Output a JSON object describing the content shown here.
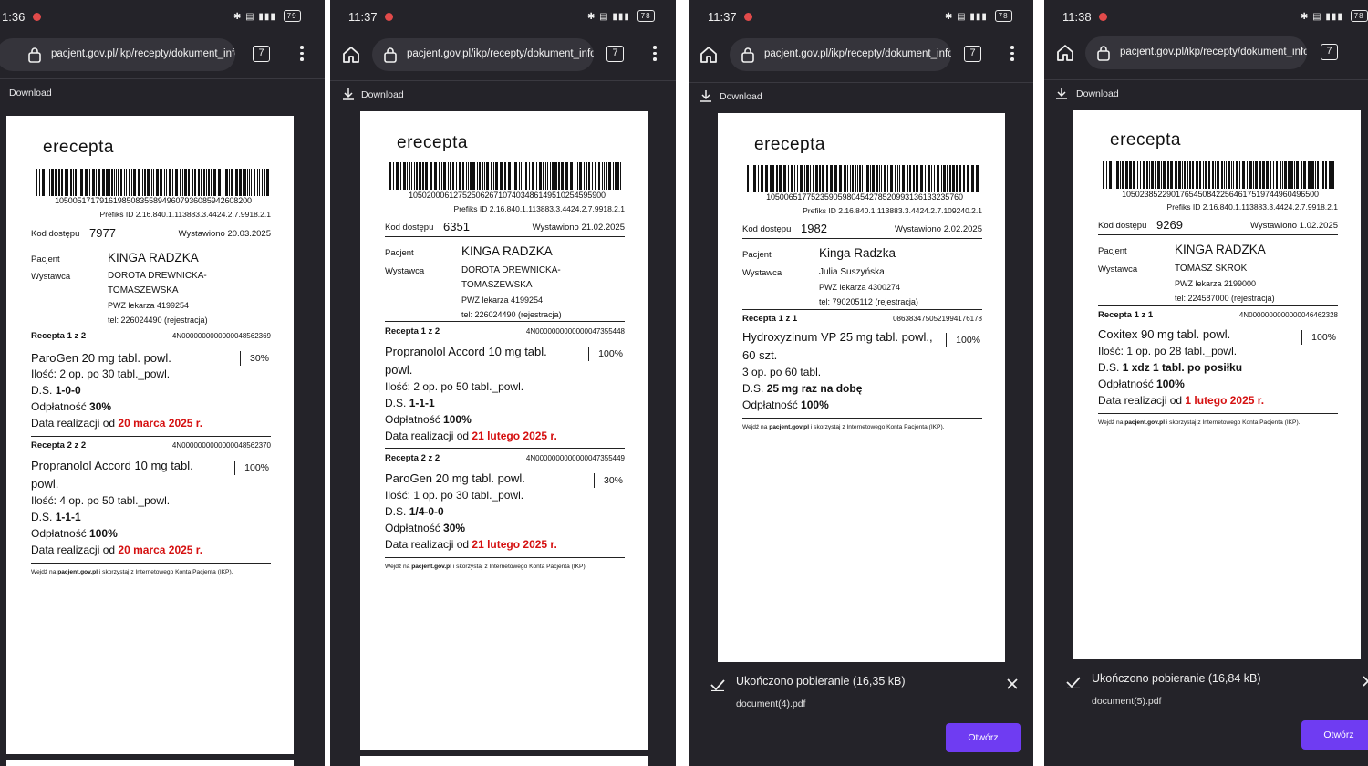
{
  "panels": [
    {
      "status_time": "1:36",
      "battery": "79",
      "url": "pacjent.gov.pl/ikp/recepty/dokument_info",
      "tab_count": "7",
      "download_label": "Download",
      "doc": {
        "logo": "erecepta",
        "barcode_number": "1050051717916198508355894960793608594260820​0",
        "prefix": "Prefiks ID 2.16.840.1.113883.3.4424.2.7.9918.2.1",
        "kod_label": "Kod dostępu",
        "kod_value": "7977",
        "wystawiono_label": "Wystawiono",
        "wystawiono_date": "20.03.2025",
        "pacjent_label": "Pacjent",
        "pacjent_name": "KINGA RADZKA",
        "wystawca_label": "Wystawca",
        "wystawca_lines": [
          "DOROTA DREWNICKA-",
          "TOMASZEWSKA",
          "PWZ lekarza 4199254",
          "tel: 226024490 (rejestracja)"
        ],
        "recepty": [
          {
            "title": "Recepta 1 z 2",
            "id": "4N0000000000000048562369",
            "drug": "ParoGen 20 mg tabl. powl.",
            "pct": "30%",
            "ilosc": "Ilość: 2 op. po 30 tabl._powl.",
            "ds_label": "D.S.",
            "ds_value": "1-0-0",
            "odp_label": "Odpłatność",
            "odp_value": "30%",
            "data_label": "Data realizacji od",
            "data_value": "20 marca 2025 r."
          },
          {
            "title": "Recepta 2 z 2",
            "id": "4N0000000000000048562370",
            "drug": "Propranolol Accord 10 mg tabl. powl.",
            "pct": "100%",
            "ilosc": "Ilość: 4 op. po 50 tabl._powl.",
            "ds_label": "D.S.",
            "ds_value": "1-1-1",
            "odp_label": "Odpłatność",
            "odp_value": "100%",
            "data_label": "Data realizacji od",
            "data_value": "20 marca 2025 r."
          }
        ],
        "footer_pre": "Wejdź na ",
        "footer_link": "pacjent.gov.pl",
        "footer_post": " i skorzystaj z Internetowego Konta Pacjenta (IKP)."
      }
    },
    {
      "status_time": "11:37",
      "battery": "78",
      "url": "pacjent.gov.pl/ikp/recepty/dokument_info",
      "tab_count": "7",
      "download_label": "Download",
      "doc": {
        "logo": "erecepta",
        "barcode_number": "1050200061275250626710740348614951025459590​0",
        "prefix": "Prefiks ID 2.16.840.1.113883.3.4424.2.7.9918.2.1",
        "kod_label": "Kod dostępu",
        "kod_value": "6351",
        "wystawiono_label": "Wystawiono",
        "wystawiono_date": "21.02.2025",
        "pacjent_label": "Pacjent",
        "pacjent_name": "KINGA RADZKA",
        "wystawca_label": "Wystawca",
        "wystawca_lines": [
          "DOROTA DREWNICKA-",
          "TOMASZEWSKA",
          "PWZ lekarza 4199254",
          "tel: 226024490 (rejestracja)"
        ],
        "recepty": [
          {
            "title": "Recepta 1 z 2",
            "id": "4N0000000000000047355448",
            "drug": "Propranolol Accord 10 mg tabl. powl.",
            "pct": "100%",
            "ilosc": "Ilość: 2 op. po 50 tabl._powl.",
            "ds_label": "D.S.",
            "ds_value": "1-1-1",
            "odp_label": "Odpłatność",
            "odp_value": "100%",
            "data_label": "Data realizacji od",
            "data_value": "21 lutego 2025 r."
          },
          {
            "title": "Recepta 2 z 2",
            "id": "4N0000000000000047355449",
            "drug": "ParoGen 20 mg tabl. powl.",
            "pct": "30%",
            "ilosc": "Ilość: 1 op. po 30 tabl._powl.",
            "ds_label": "D.S.",
            "ds_value": "1/4-0-0",
            "odp_label": "Odpłatność",
            "odp_value": "30%",
            "data_label": "Data realizacji od",
            "data_value": "21 lutego 2025 r."
          }
        ],
        "footer_pre": "Wejdź na ",
        "footer_link": "pacjent.gov.pl",
        "footer_post": " i skorzystaj z Internetowego Konta Pacjenta (IKP)."
      }
    },
    {
      "status_time": "11:37",
      "battery": "78",
      "url": "pacjent.gov.pl/ikp/recepty/dokument_info",
      "tab_count": "7",
      "download_label": "Download",
      "doc": {
        "logo": "erecepta",
        "barcode_number": "1050065177523590598045427852099313613323576​0",
        "prefix": "Prefiks ID 2.16.840.1.113883.3.4424.2.7.109240.2.1",
        "kod_label": "Kod dostępu",
        "kod_value": "1982",
        "wystawiono_label": "Wystawiono",
        "wystawiono_date": "2.02.2025",
        "pacjent_label": "Pacjent",
        "pacjent_name": "Kinga Radzka",
        "wystawca_label": "Wystawca",
        "wystawca_lines": [
          "Julia Suszyńska",
          "PWZ lekarza 4300274",
          "tel: 790205112 (rejestracja)"
        ],
        "recepty": [
          {
            "title": "Recepta 1 z 1",
            "id": "0863834750521994176178",
            "drug": "Hydroxyzinum VP 25 mg tabl. powl., 60 szt.",
            "pct": "100%",
            "ilosc": "3 op. po 60 tabl.",
            "ds_label": "D.S.",
            "ds_value": "25 mg raz na dobę",
            "odp_label": "Odpłatność",
            "odp_value": "100%",
            "data_label": "",
            "data_value": ""
          }
        ],
        "footer_pre": "Wejdź na ",
        "footer_link": "pacjent.gov.pl",
        "footer_post": " i skorzystaj z Internetowego Konta Pacjenta (IKP)."
      },
      "download_done": {
        "title": "Ukończono pobieranie (16,35 kB)",
        "file": "document(4).pdf",
        "open_label": "Otwórz"
      }
    },
    {
      "status_time": "11:38",
      "battery": "78",
      "url": "pacjent.gov.pl/ikp/recepty/dokument_info",
      "tab_count": "7",
      "download_label": "Download",
      "doc": {
        "logo": "erecepta",
        "barcode_number": "1050238522901765450842256461751974496049650​0",
        "prefix": "Prefiks ID 2.16.840.1.113883.3.4424.2.7.9918.2.1",
        "kod_label": "Kod dostępu",
        "kod_value": "9269",
        "wystawiono_label": "Wystawiono",
        "wystawiono_date": "1.02.2025",
        "pacjent_label": "Pacjent",
        "pacjent_name": "KINGA RADZKA",
        "wystawca_label": "Wystawca",
        "wystawca_lines": [
          "TOMASZ SKROK",
          "PWZ lekarza 2199000",
          "tel: 224587000 (rejestracja)"
        ],
        "recepty": [
          {
            "title": "Recepta 1 z 1",
            "id": "4N0000000000000046462328",
            "drug": "Coxitex 90 mg tabl. powl.",
            "pct": "100%",
            "ilosc": "Ilość: 1 op. po 28 tabl._powl.",
            "ds_label": "D.S.",
            "ds_value": "1 xdz 1 tabl. po posiłku",
            "odp_label": "Odpłatność",
            "odp_value": "100%",
            "data_label": "Data realizacji od",
            "data_value": "1 lutego 2025 r."
          }
        ],
        "footer_pre": "Wejdź na ",
        "footer_link": "pacjent.gov.pl",
        "footer_post": " i skorzystaj z Internetowego Konta Pacjenta (IKP)."
      },
      "download_done": {
        "title": "Ukończono pobieranie (16,84 kB)",
        "file": "document(5).pdf",
        "open_label": "Otwórz"
      }
    }
  ]
}
